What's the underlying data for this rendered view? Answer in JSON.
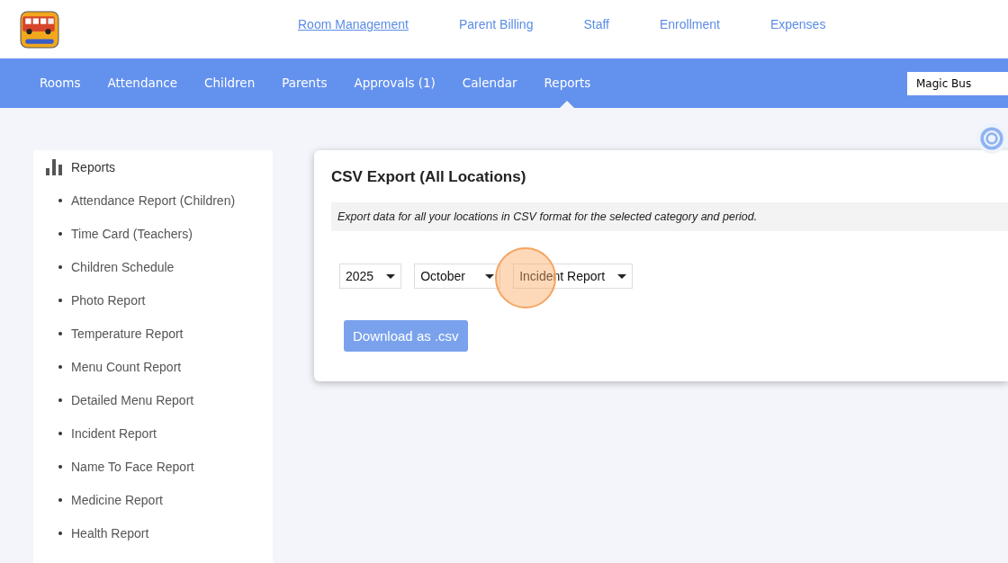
{
  "top_links": [
    {
      "label": "Room Management",
      "selected": true
    },
    {
      "label": "Parent Billing",
      "selected": false
    },
    {
      "label": "Staff",
      "selected": false
    },
    {
      "label": "Enrollment",
      "selected": false
    },
    {
      "label": "Expenses",
      "selected": false
    }
  ],
  "nav_tabs": [
    {
      "label": "Rooms",
      "selected": false
    },
    {
      "label": "Attendance",
      "selected": false
    },
    {
      "label": "Children",
      "selected": false
    },
    {
      "label": "Parents",
      "selected": false
    },
    {
      "label": "Approvals (1)",
      "selected": false
    },
    {
      "label": "Calendar",
      "selected": false
    },
    {
      "label": "Reports",
      "selected": true
    }
  ],
  "location_field": {
    "value": "Magic Bus"
  },
  "sidebar": {
    "title": "Reports",
    "items": [
      "Attendance Report (Children)",
      "Time Card (Teachers)",
      "Children Schedule",
      "Photo Report",
      "Temperature Report",
      "Menu Count Report",
      "Detailed Menu Report",
      "Incident Report",
      "Name To Face Report",
      "Medicine Report",
      "Health Report"
    ]
  },
  "card": {
    "title": "CSV Export (All Locations)",
    "note": "Export data for all your locations in CSV format for the selected category and period.",
    "selects": [
      {
        "value": "2025"
      },
      {
        "value": "October"
      },
      {
        "value": "Incident Report"
      }
    ],
    "button": "Download as .csv"
  }
}
